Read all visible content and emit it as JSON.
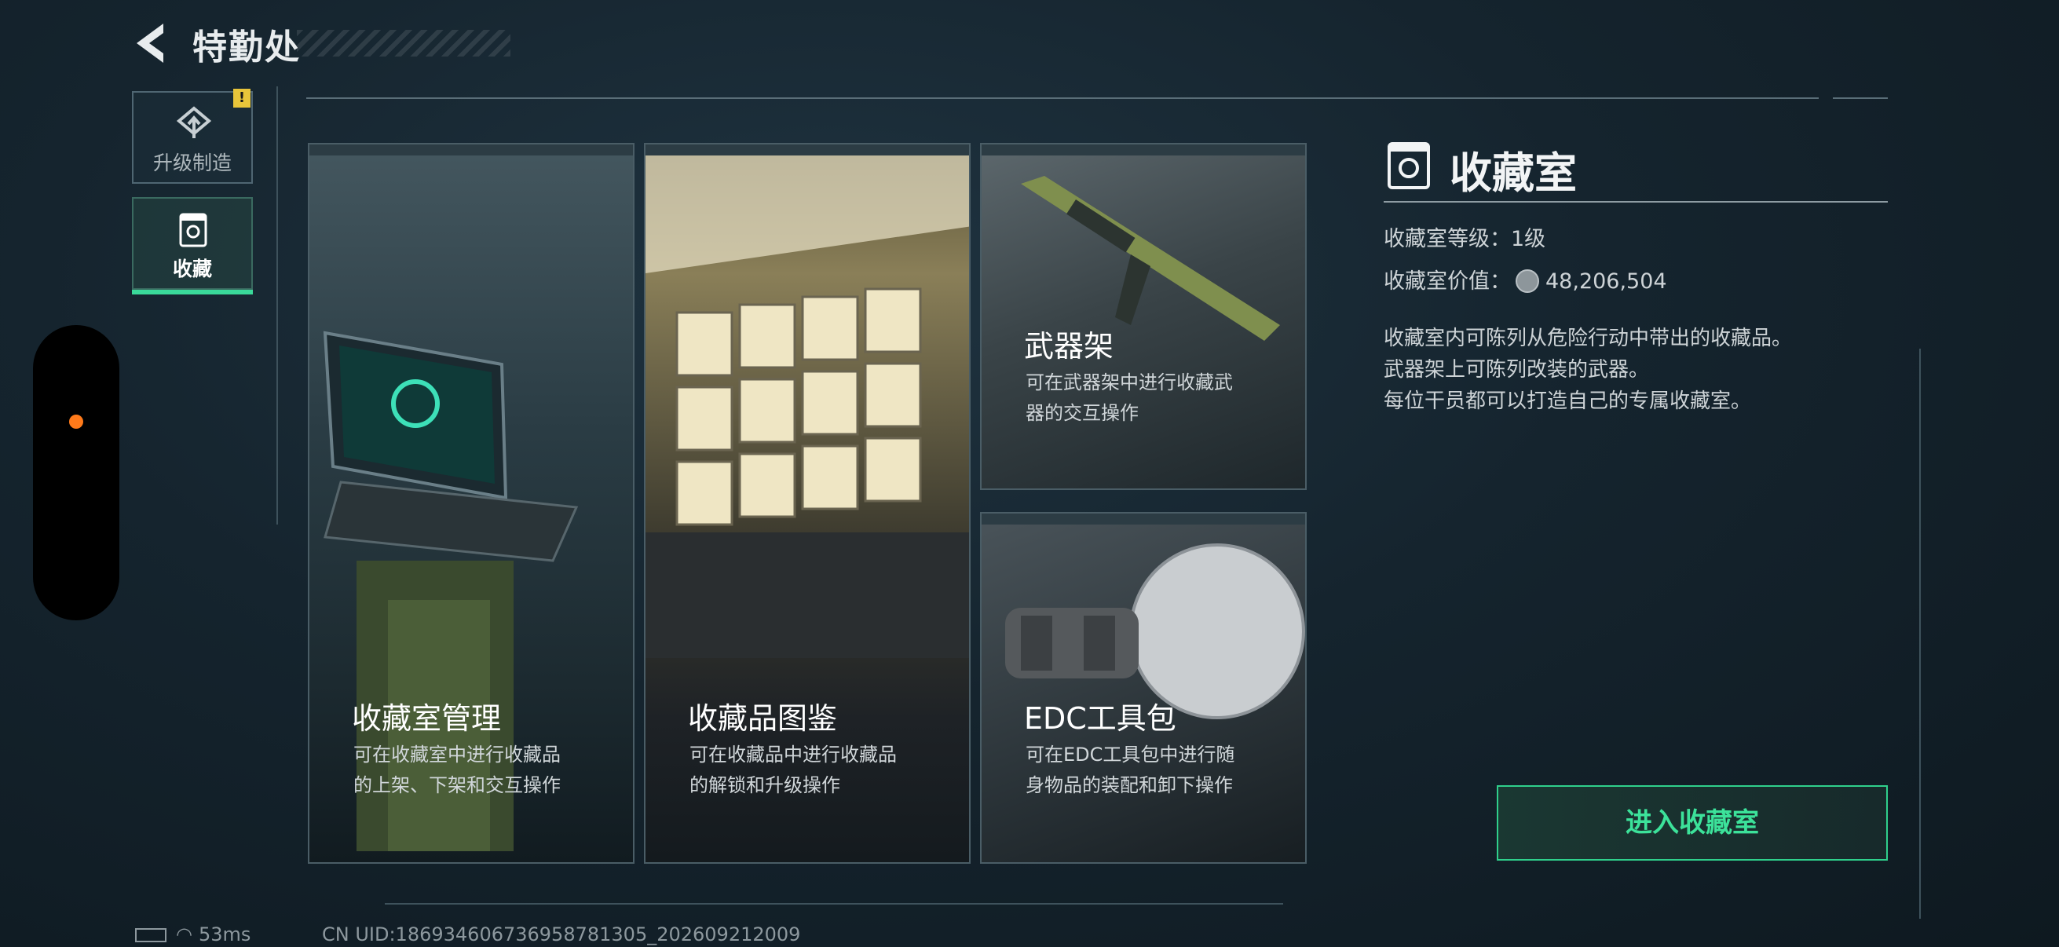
{
  "header": {
    "title": "特勤处"
  },
  "nav": {
    "items": [
      {
        "label": "升级制造",
        "icon": "upgrade-icon",
        "alert": "!"
      },
      {
        "label": "收藏",
        "icon": "vault-icon",
        "active": true
      }
    ]
  },
  "cards": {
    "manage": {
      "title": "收藏室管理",
      "desc": [
        "可在收藏室中进行收藏品",
        "的上架、下架和交互操作"
      ]
    },
    "catalog": {
      "title": "收藏品图鉴",
      "desc": [
        "可在收藏品中进行收藏品",
        "的解锁和升级操作"
      ]
    },
    "rack": {
      "title": "武器架",
      "desc": [
        "可在武器架中进行收藏武",
        "器的交互操作"
      ]
    },
    "edc": {
      "title": "EDC工具包",
      "desc": [
        "可在EDC工具包中进行随",
        "身物品的装配和卸下操作"
      ]
    }
  },
  "detail": {
    "title": "收藏室",
    "level_label": "收藏室等级：",
    "level_value": "1级",
    "value_label": "收藏室价值：",
    "value_amount": "48,206,504",
    "description": [
      "收藏室内可陈列从危险行动中带出的收藏品。",
      "武器架上可陈列改装的武器。",
      "每位干员都可以打造自己的专属收藏室。"
    ],
    "enter_button": "进入收藏室"
  },
  "status": {
    "ping": "53ms",
    "uid": "CN UID:18693460673695878130​5_202609212009"
  },
  "colors": {
    "accent": "#3ce29a",
    "alert": "#e8c53a",
    "indicator": "#ff7a1a"
  }
}
